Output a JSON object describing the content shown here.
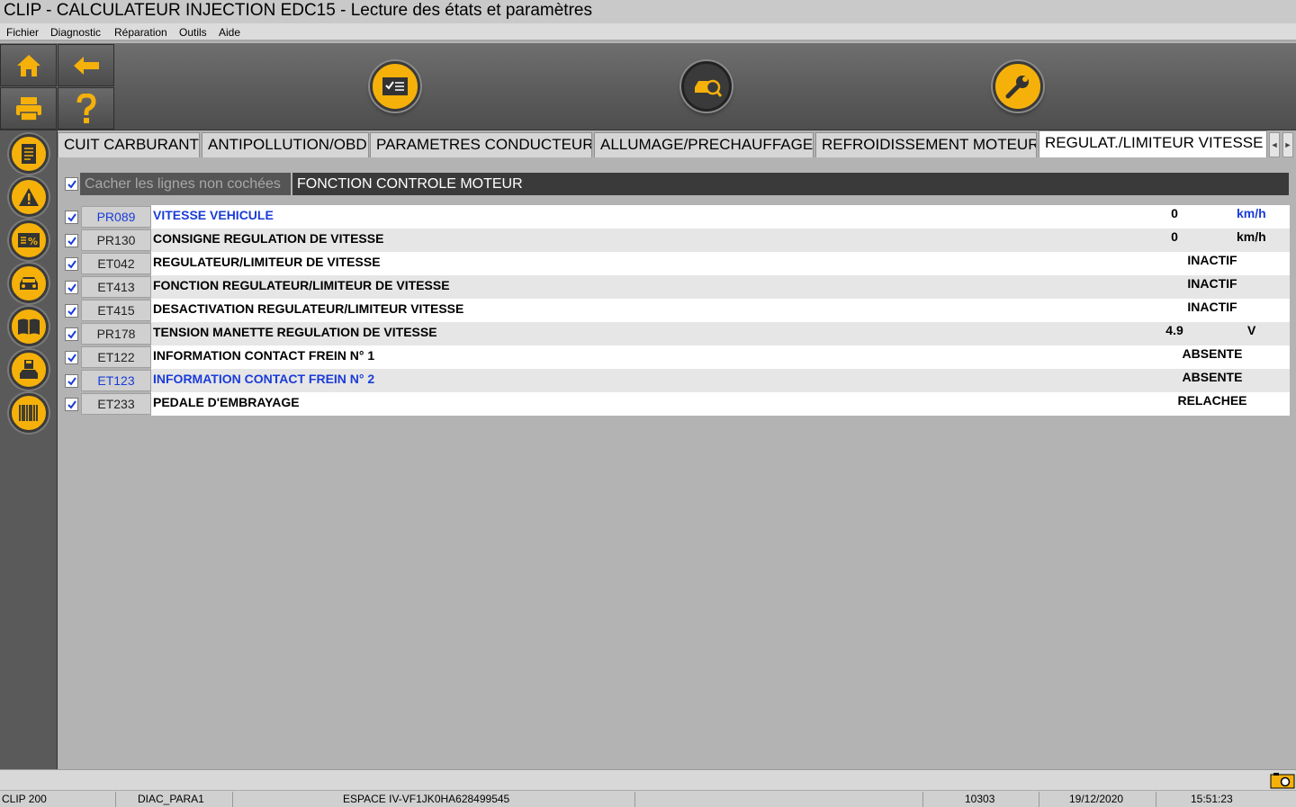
{
  "window": {
    "title": "CLIP - CALCULATEUR INJECTION EDC15 - Lecture des états et paramètres"
  },
  "menu": [
    "Fichier",
    "Diagnostic",
    "Réparation",
    "Outils",
    "Aide"
  ],
  "tabs": [
    "CUIT CARBURANT",
    "ANTIPOLLUTION/OBD",
    "PARAMETRES CONDUCTEUR",
    "ALLUMAGE/PRECHAUFFAGE",
    "REFROIDISSEMENT MOTEUR",
    "REGULAT./LIMITEUR VITESSE"
  ],
  "active_tab": "REGULAT./LIMITEUR VITESSE",
  "filter": {
    "label": "Cacher les lignes non cochées",
    "checked": true
  },
  "section_title": "FONCTION CONTROLE MOTEUR",
  "rows": [
    {
      "code": "PR089",
      "name": "VITESSE VEHICULE",
      "value": "0",
      "unit": "km/h",
      "highlight": true
    },
    {
      "code": "PR130",
      "name": "CONSIGNE REGULATION DE VITESSE",
      "value": "0",
      "unit": "km/h",
      "highlight": false
    },
    {
      "code": "ET042",
      "name": "REGULATEUR/LIMITEUR DE VITESSE",
      "value": "INACTIF",
      "unit": "",
      "highlight": false
    },
    {
      "code": "ET413",
      "name": "FONCTION REGULATEUR/LIMITEUR DE VITESSE",
      "value": "INACTIF",
      "unit": "",
      "highlight": false
    },
    {
      "code": "ET415",
      "name": "DESACTIVATION REGULATEUR/LIMITEUR VITESSE",
      "value": "INACTIF",
      "unit": "",
      "highlight": false
    },
    {
      "code": "PR178",
      "name": "TENSION MANETTE REGULATION DE VITESSE",
      "value": "4.9",
      "unit": "V",
      "highlight": false
    },
    {
      "code": "ET122",
      "name": "INFORMATION CONTACT FREIN N° 1",
      "value": "ABSENTE",
      "unit": "",
      "highlight": false
    },
    {
      "code": "ET123",
      "name": "INFORMATION CONTACT FREIN N° 2",
      "value": "ABSENTE",
      "unit": "",
      "highlight": true
    },
    {
      "code": "ET233",
      "name": "PEDALE D'EMBRAYAGE",
      "value": "RELACHEE",
      "unit": "",
      "highlight": false
    }
  ],
  "status": {
    "product": "CLIP 200",
    "diag": "DIAC_PARA1",
    "vehicle": "ESPACE IV-VF1JK0HA628499545",
    "field4": "",
    "code": "10303",
    "date": "19/12/2020",
    "time": "15:51:23"
  },
  "colors": {
    "accent": "#f5b10a",
    "link_blue": "#1a3cd8",
    "toolbar_dark": "#5a5a5a"
  },
  "icons": {
    "toolbar_left": [
      "home-icon",
      "back-arrow-icon",
      "print-icon",
      "help-icon"
    ],
    "toolbar_round": [
      "checklist-icon",
      "diagnostic-car-icon",
      "wrench-icon"
    ],
    "sidebar": [
      "document-icon",
      "warning-icon",
      "parameters-percent-icon",
      "car-icon",
      "book-icon",
      "save-car-icon",
      "barcode-icon"
    ],
    "status": "camera-icon"
  }
}
